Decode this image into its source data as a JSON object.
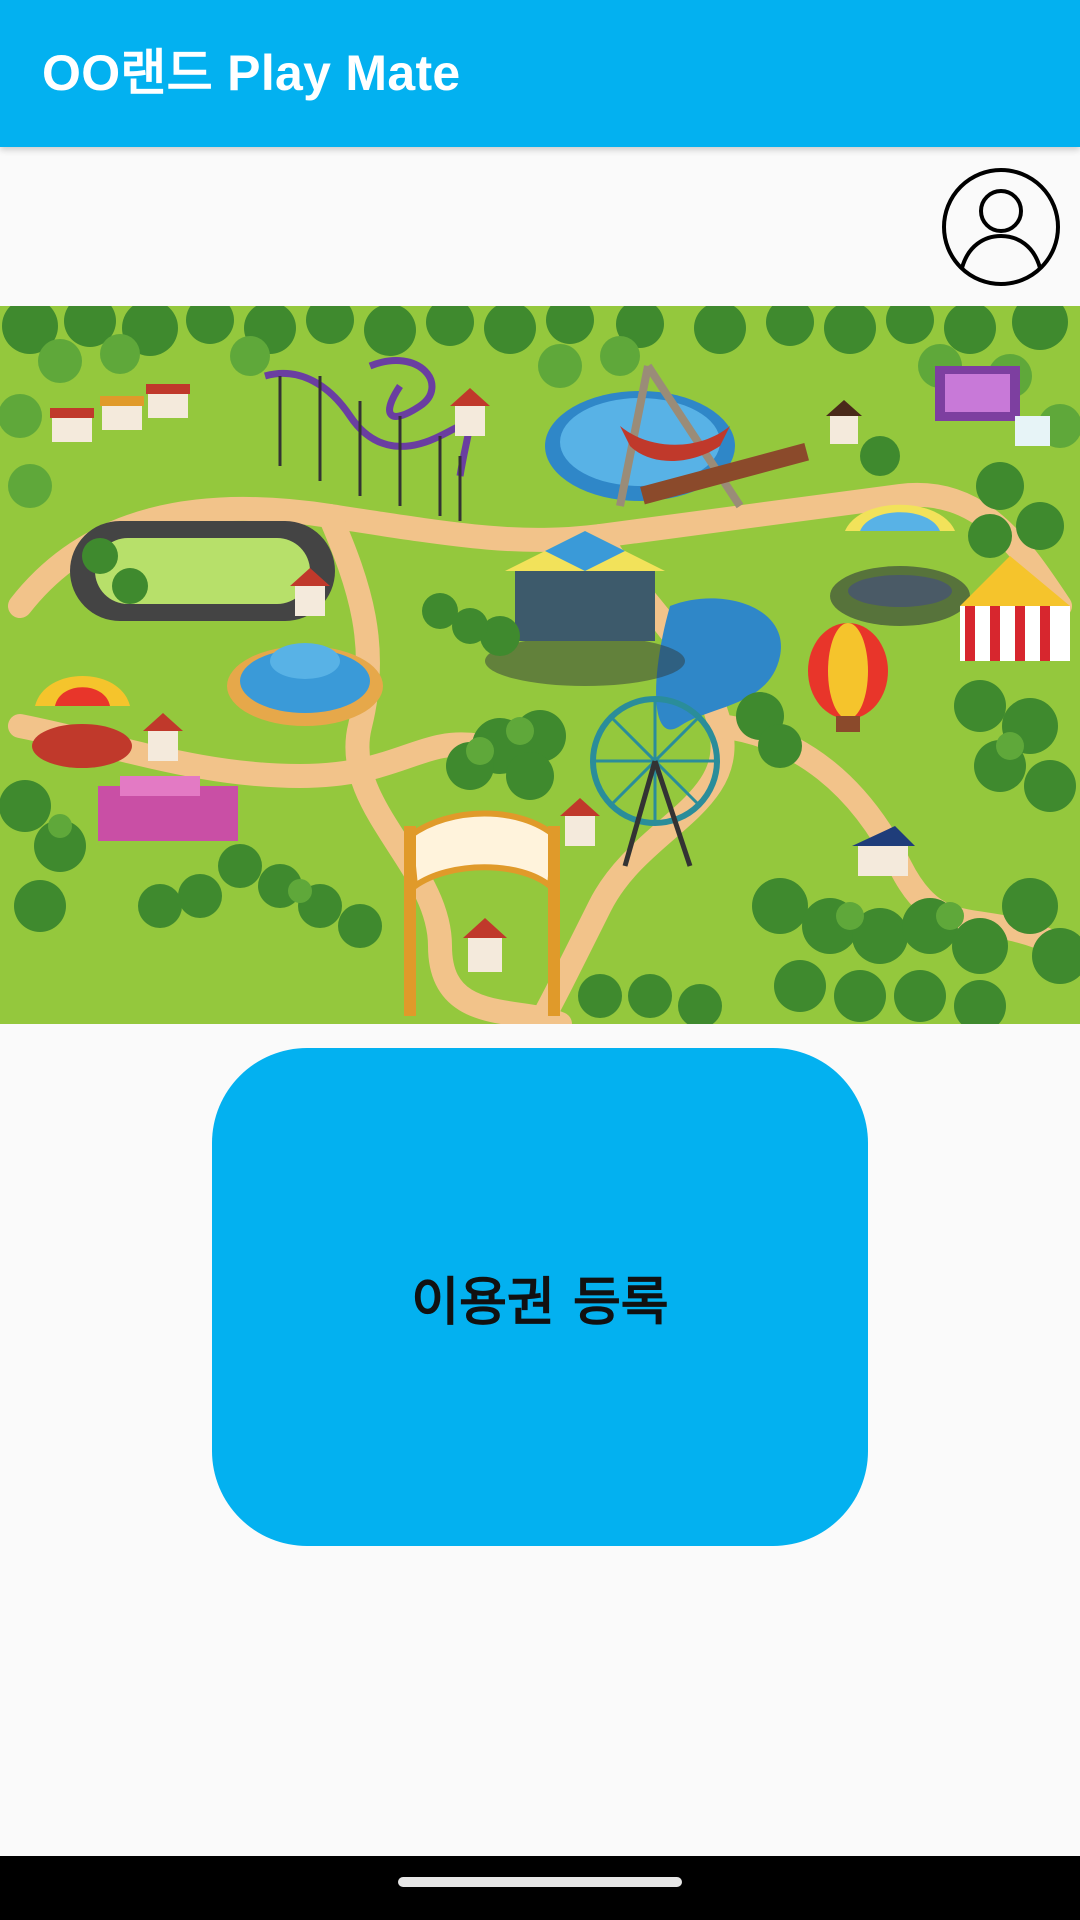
{
  "app_bar": {
    "title": "OO랜드 Play Mate",
    "background_color": "#03b1f0"
  },
  "profile": {
    "icon": "account-circle-icon"
  },
  "hero_image": {
    "subject": "amusement-park-map-illustration"
  },
  "main": {
    "register_button_label": "이용권 등록",
    "register_button_color": "#03b1f0"
  },
  "system_nav": {
    "home_indicator": "home-gesture-bar"
  }
}
